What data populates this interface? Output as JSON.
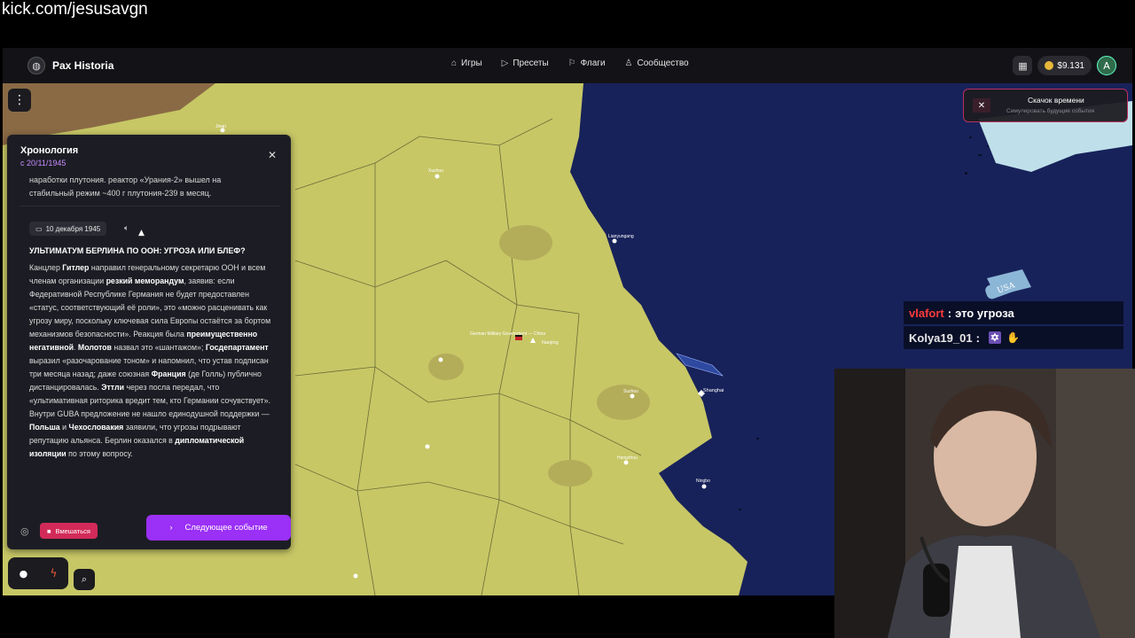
{
  "stream_url": "kick.com/jesusavgn",
  "app": {
    "name": "Pax Historia",
    "nav": [
      {
        "label": "Игры",
        "icon": "gamepad-icon"
      },
      {
        "label": "Пресеты",
        "icon": "play-icon"
      },
      {
        "label": "Флаги",
        "icon": "flag-icon"
      },
      {
        "label": "Сообщество",
        "icon": "users-icon"
      }
    ],
    "balance": "$9.131",
    "avatar": "A"
  },
  "timeline": {
    "title": "Хронология",
    "date": "с 20/11/1945",
    "prev_text_1": "наработки плутония. реактор «Урания-2» вышел на",
    "prev_text_2": "стабильный режим ~400 г плутония-239 в месяц.",
    "event_date": "10 декабря 1945",
    "event_title": "УЛЬТИМАТУМ БЕРЛИНА ПО ООН: УГРОЗА ИЛИ БЛЕФ?",
    "intervene": "Вмешаться",
    "next_event": "Следующее событие"
  },
  "time_jump": {
    "title": "Скачок времени",
    "subtitle": "Симулировать будущие события"
  },
  "map_labels": {
    "usa": "USA",
    "nanjing": "Nanjing",
    "shanghai": "Shanghai"
  },
  "chat": [
    {
      "user": "vlafort",
      "sep": ":",
      "message": "это угроза",
      "color": "#ff3b3b"
    },
    {
      "user": "Kolya19_01",
      "sep": ":",
      "message": "",
      "color": "#e8e8e8"
    }
  ],
  "colors": {
    "land": "#c7c766",
    "sea": "#18225a",
    "accent_purple": "#9b30f6",
    "accent_red": "#d22a59"
  }
}
